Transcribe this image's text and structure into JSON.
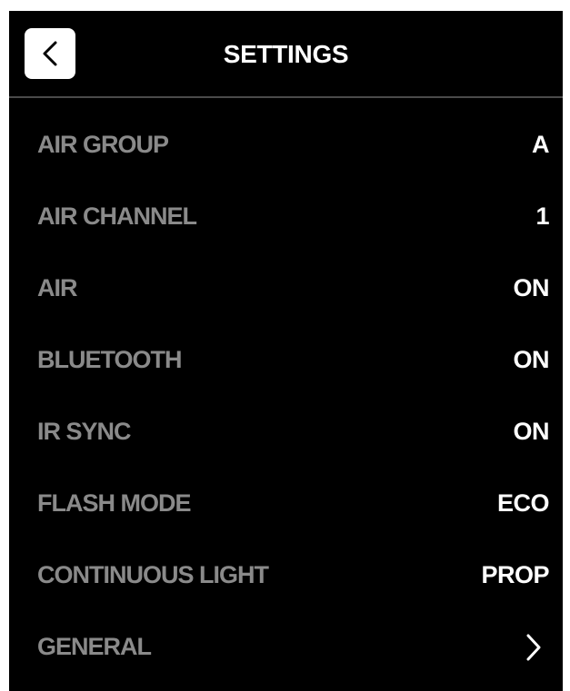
{
  "header": {
    "title": "SETTINGS",
    "back_icon": "chevron-left-icon"
  },
  "settings": [
    {
      "label": "AIR GROUP",
      "value": "A"
    },
    {
      "label": "AIR CHANNEL",
      "value": "1"
    },
    {
      "label": "AIR",
      "value": "ON"
    },
    {
      "label": "BLUETOOTH",
      "value": "ON"
    },
    {
      "label": "IR SYNC",
      "value": "ON"
    },
    {
      "label": "FLASH MODE",
      "value": "ECO"
    },
    {
      "label": "CONTINUOUS LIGHT",
      "value": "PROP"
    },
    {
      "label": "GENERAL",
      "icon": "chevron-right-icon"
    }
  ],
  "colors": {
    "background": "#000000",
    "label": "#8a8a8a",
    "value": "#ffffff",
    "divider": "#4a4a4a"
  }
}
